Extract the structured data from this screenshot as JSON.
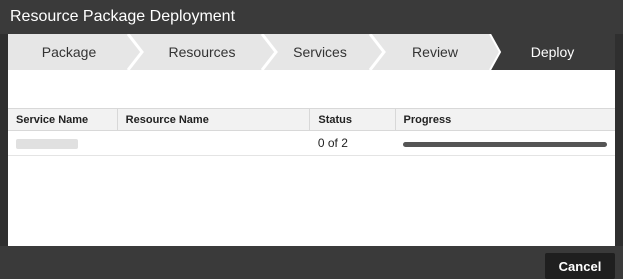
{
  "window": {
    "title": "Resource Package Deployment"
  },
  "steps": [
    {
      "label": "Package"
    },
    {
      "label": "Resources"
    },
    {
      "label": "Services"
    },
    {
      "label": "Review"
    },
    {
      "label": "Deploy"
    }
  ],
  "table": {
    "columns": [
      "Service Name",
      "Resource Name",
      "Status",
      "Progress"
    ],
    "rows": [
      {
        "service_name": "",
        "resource_name": "",
        "status": "0 of 2",
        "progress": 1.0
      }
    ]
  },
  "footer": {
    "cancel_label": "Cancel"
  },
  "colors": {
    "title_bar": "#3a3a3a",
    "step_bg": "#e6e6e6",
    "active_step_bg": "#3a3a3a",
    "progress_fill": "#555555"
  }
}
